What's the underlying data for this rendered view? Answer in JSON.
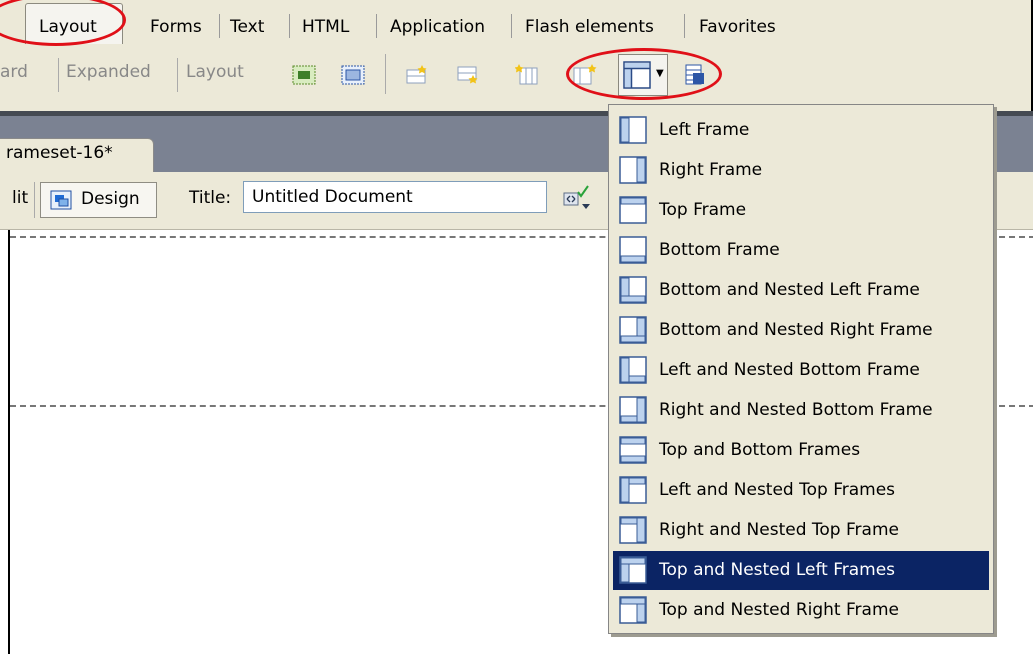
{
  "tabs": [
    "Layout",
    "Forms",
    "Text",
    "HTML",
    "Application",
    "Flash elements",
    "Favorites"
  ],
  "toolbar": {
    "modes": [
      "ard",
      "Expanded",
      "Layout"
    ]
  },
  "document": {
    "tab_title": "rameset-16*",
    "view_left": "lit",
    "design_label": "Design",
    "title_label": "Title:",
    "title_value": "Untitled Document"
  },
  "frames_menu": {
    "items": [
      {
        "label": "Left Frame",
        "icon": "frame-left-icon"
      },
      {
        "label": "Right Frame",
        "icon": "frame-right-icon"
      },
      {
        "label": "Top Frame",
        "icon": "frame-top-icon"
      },
      {
        "label": "Bottom Frame",
        "icon": "frame-bottom-icon"
      },
      {
        "label": "Bottom and Nested Left Frame",
        "icon": "frame-bottom-nested-left-icon"
      },
      {
        "label": "Bottom and Nested Right Frame",
        "icon": "frame-bottom-nested-right-icon"
      },
      {
        "label": "Left and Nested Bottom Frame",
        "icon": "frame-left-nested-bottom-icon"
      },
      {
        "label": "Right and Nested Bottom Frame",
        "icon": "frame-right-nested-bottom-icon"
      },
      {
        "label": "Top and Bottom Frames",
        "icon": "frame-top-bottom-icon"
      },
      {
        "label": "Left and Nested Top Frames",
        "icon": "frame-left-nested-top-icon"
      },
      {
        "label": "Right and Nested Top Frame",
        "icon": "frame-right-nested-top-icon"
      },
      {
        "label": "Top and Nested Left Frames",
        "icon": "frame-top-nested-left-icon",
        "selected": true
      },
      {
        "label": "Top and Nested Right Frame",
        "icon": "frame-top-nested-right-icon"
      }
    ]
  },
  "colors": {
    "annotation": "#e01018",
    "selection": "#0b2464",
    "frame_fill": "#bcd2ee",
    "frame_border": "#3a5c96"
  }
}
